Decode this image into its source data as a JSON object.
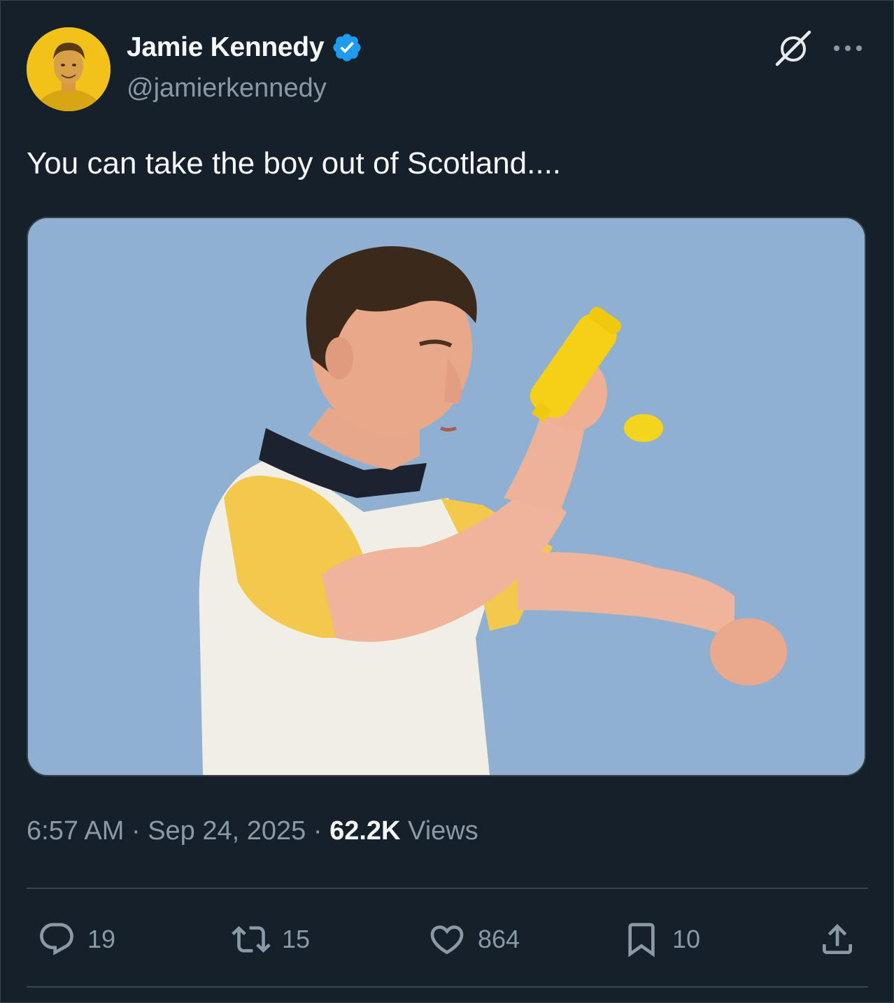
{
  "author": {
    "display_name": "Jamie Kennedy",
    "handle": "@jamierkennedy",
    "verified": true,
    "avatar_bg": "#f2c21b"
  },
  "header_icons": {
    "grok": "grok-icon",
    "more": "more-icon"
  },
  "tweet": {
    "text": "You can take the boy out of Scotland....",
    "media": {
      "type": "photo",
      "alt_icon": "photo"
    },
    "time": "6:57 AM",
    "separator": "·",
    "date": "Sep 24, 2025",
    "views_count": "62.2K",
    "views_label": "Views"
  },
  "actions": {
    "replies": {
      "icon": "reply-icon",
      "count": "19"
    },
    "reposts": {
      "icon": "repost-icon",
      "count": "15"
    },
    "likes": {
      "icon": "like-icon",
      "count": "864"
    },
    "bookmarks": {
      "icon": "bookmark-icon",
      "count": "10"
    },
    "share": {
      "icon": "share-icon"
    }
  },
  "colors": {
    "background": "#15202b",
    "text": "#f7f9f9",
    "secondary": "#8b98a5",
    "border": "#38444d",
    "verified": "#1d9bf0"
  }
}
